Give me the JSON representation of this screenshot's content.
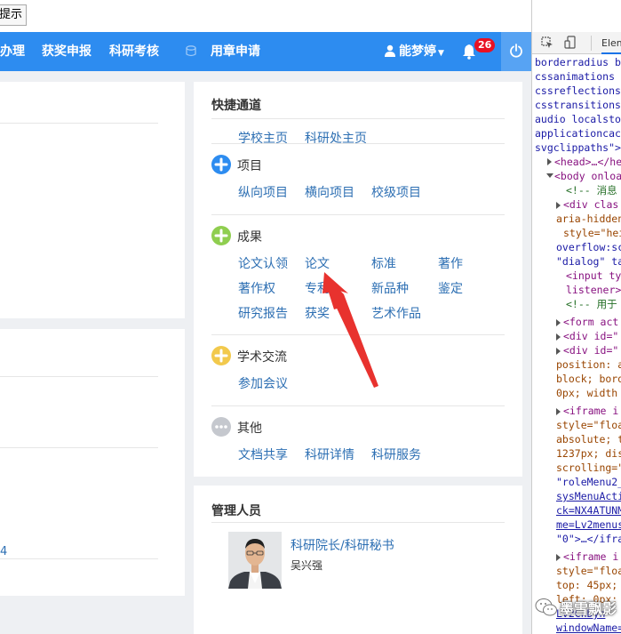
{
  "top_button": "提示",
  "nav": {
    "items": [
      "办理",
      "获奖申报",
      "科研考核",
      "用章申请"
    ],
    "user": "能梦婷",
    "badge": "26"
  },
  "left": {
    "link": "4"
  },
  "quick": {
    "title": "快捷通道",
    "top_links": [
      "学校主页",
      "科研处主页"
    ],
    "sections": [
      {
        "title": "项目",
        "links": [
          "纵向项目",
          "横向项目",
          "校级项目"
        ]
      },
      {
        "title": "成果",
        "links": [
          "论文认领",
          "论文",
          "标准",
          "著作",
          "著作权",
          "专利",
          "新品种",
          "鉴定",
          "研究报告",
          "获奖",
          "艺术作品"
        ]
      },
      {
        "title": "学术交流",
        "links": [
          "参加会议"
        ]
      },
      {
        "title": "其他",
        "links": [
          "文档共享",
          "科研详情",
          "科研服务"
        ]
      }
    ],
    "colors": {
      "project": "#2d8cf0",
      "result": "#8fce4f",
      "academic": "#f2c94c",
      "other": "#c5c8ce"
    }
  },
  "admin": {
    "title": "管理人员",
    "role": "科研院长/科研秘书",
    "name": "吴兴强"
  },
  "devtools": {
    "tab": "Elem",
    "lines": [
      "borderradius b",
      "cssanimations",
      "cssreflections",
      "csstransitions",
      "audio localsto",
      "applicationcac",
      "svgclippaths\">",
      "<head>…</he",
      "<body onloa",
      "<!-- 消息",
      "<div clas",
      "aria-hidden",
      "style=\"hei",
      "overflow:sc",
      "\"dialog\" ta",
      "<input ty",
      "listener>",
      "<!-- 用于",
      "<form act",
      "<div id=\"",
      "<div id=\"",
      "position: a",
      "block; bord",
      "0px; width",
      "<iframe i",
      "style=\"floa",
      "absolute; t",
      "1237px; dis",
      "scrolling=\"",
      "\"roleMenu2_",
      "sysMenuActi",
      "ck=NX4ATUNM",
      "me=Lv2menus",
      "\"0\">…</ifra",
      "<iframe i",
      "style=\"floa",
      "top: 45px;",
      "left: 0px;",
      "Lv2ChDyn",
      "windowName="
    ]
  },
  "watermark": "墨雪飘影"
}
